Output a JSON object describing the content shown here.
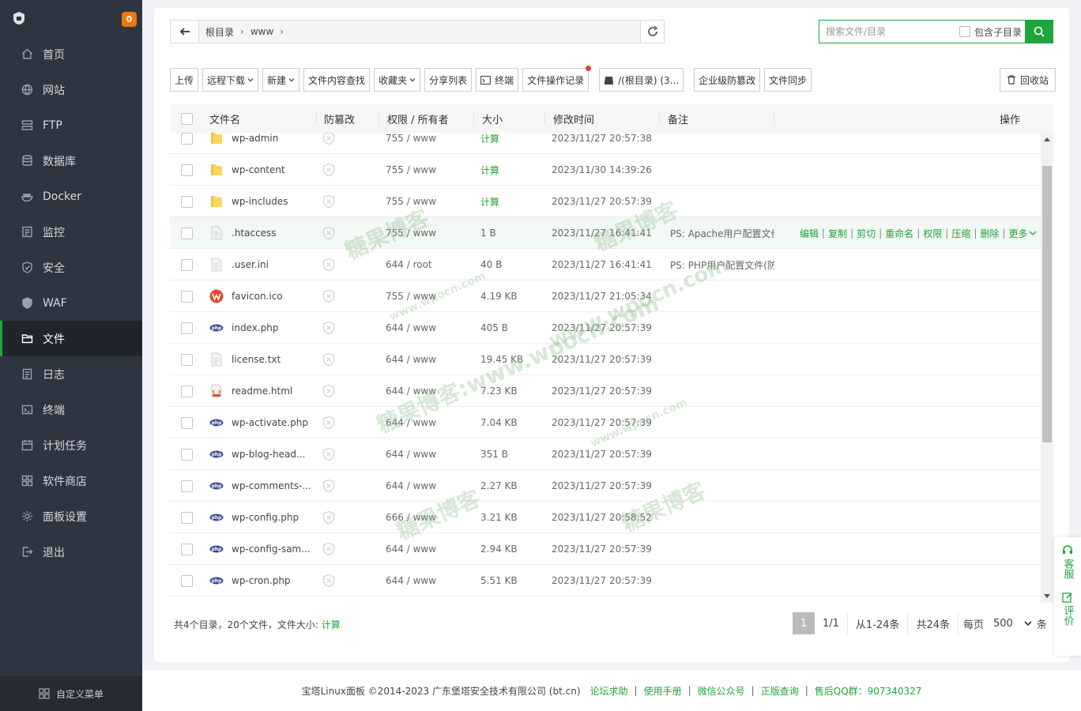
{
  "sidebar": {
    "badge": "0",
    "items": [
      {
        "label": "首页",
        "icon": "home-icon"
      },
      {
        "label": "网站",
        "icon": "globe-icon"
      },
      {
        "label": "FTP",
        "icon": "ftp-icon"
      },
      {
        "label": "数据库",
        "icon": "database-icon"
      },
      {
        "label": "Docker",
        "icon": "docker-icon"
      },
      {
        "label": "监控",
        "icon": "monitor-icon"
      },
      {
        "label": "安全",
        "icon": "shield-icon"
      },
      {
        "label": "WAF",
        "icon": "waf-icon"
      },
      {
        "label": "文件",
        "icon": "folder-icon"
      },
      {
        "label": "日志",
        "icon": "log-icon"
      },
      {
        "label": "终端",
        "icon": "terminal-icon"
      },
      {
        "label": "计划任务",
        "icon": "calendar-icon"
      },
      {
        "label": "软件商店",
        "icon": "apps-icon"
      },
      {
        "label": "面板设置",
        "icon": "gear-icon"
      },
      {
        "label": "退出",
        "icon": "logout-icon"
      }
    ],
    "active_index": 8,
    "custom_menu": "自定义菜单"
  },
  "path": {
    "crumbs": [
      "根目录",
      "www"
    ]
  },
  "search": {
    "placeholder": "搜索文件/目录",
    "include_sub": "包含子目录"
  },
  "toolbar": {
    "upload": "上传",
    "remote_download": "远程下载",
    "new": "新建",
    "content_search": "文件内容查找",
    "favorites": "收藏夹",
    "share_list": "分享列表",
    "terminal": "终端",
    "op_log": "文件操作记录",
    "disk": "/(根目录) (3...",
    "tamper": "企业级防篡改",
    "sync": "文件同步",
    "recycle": "回收站"
  },
  "table": {
    "headers": {
      "name": "文件名",
      "tamper": "防篡改",
      "perm": "权限 / 所有者",
      "size": "大小",
      "mtime": "修改时间",
      "note": "备注",
      "ops": "操作"
    },
    "rows": [
      {
        "name": "wp-admin",
        "type": "folder",
        "perm": "755 / www",
        "size": "计算",
        "mtime": "2023/11/27 20:57:38",
        "note": ""
      },
      {
        "name": "wp-content",
        "type": "folder",
        "perm": "755 / www",
        "size": "计算",
        "mtime": "2023/11/30 14:39:26",
        "note": ""
      },
      {
        "name": "wp-includes",
        "type": "folder",
        "perm": "755 / www",
        "size": "计算",
        "mtime": "2023/11/27 20:57:39",
        "note": ""
      },
      {
        "name": ".htaccess",
        "type": "text",
        "perm": "755 / www",
        "size": "1 B",
        "mtime": "2023/11/27 16:41:41",
        "note": "PS: Apache用户配置文件"
      },
      {
        "name": ".user.ini",
        "type": "text",
        "perm": "644 / root",
        "size": "40 B",
        "mtime": "2023/11/27 16:41:41",
        "note": "PS: PHP用户配置文件(防"
      },
      {
        "name": "favicon.ico",
        "type": "ico",
        "perm": "755 / www",
        "size": "4.19 KB",
        "mtime": "2023/11/27 21:05:34",
        "note": ""
      },
      {
        "name": "index.php",
        "type": "php",
        "perm": "644 / www",
        "size": "405 B",
        "mtime": "2023/11/27 20:57:39",
        "note": ""
      },
      {
        "name": "license.txt",
        "type": "text",
        "perm": "644 / www",
        "size": "19.45 KB",
        "mtime": "2023/11/27 20:57:39",
        "note": ""
      },
      {
        "name": "readme.html",
        "type": "html",
        "perm": "644 / www",
        "size": "7.23 KB",
        "mtime": "2023/11/27 20:57:39",
        "note": ""
      },
      {
        "name": "wp-activate.php",
        "type": "php",
        "perm": "644 / www",
        "size": "7.04 KB",
        "mtime": "2023/11/27 20:57:39",
        "note": ""
      },
      {
        "name": "wp-blog-head...",
        "type": "php",
        "perm": "644 / www",
        "size": "351 B",
        "mtime": "2023/11/27 20:57:39",
        "note": ""
      },
      {
        "name": "wp-comments-...",
        "type": "php",
        "perm": "644 / www",
        "size": "2.27 KB",
        "mtime": "2023/11/27 20:57:39",
        "note": ""
      },
      {
        "name": "wp-config.php",
        "type": "php",
        "perm": "666 / www",
        "size": "3.21 KB",
        "mtime": "2023/11/27 20:58:52",
        "note": ""
      },
      {
        "name": "wp-config-sam...",
        "type": "php",
        "perm": "644 / www",
        "size": "2.94 KB",
        "mtime": "2023/11/27 20:57:39",
        "note": ""
      },
      {
        "name": "wp-cron.php",
        "type": "php",
        "perm": "644 / www",
        "size": "5.51 KB",
        "mtime": "2023/11/27 20:57:39",
        "note": ""
      }
    ],
    "hover_row": 3,
    "row_actions": [
      "编辑",
      "复制",
      "剪切",
      "重命名",
      "权限",
      "压缩",
      "删除",
      "更多"
    ]
  },
  "summary": {
    "text": "共4个目录，20个文件，文件大小:",
    "calc": "计算"
  },
  "pager": {
    "current": "1",
    "pages": "1/1",
    "range": "从1-24条",
    "total": "共24条",
    "per_page_label": "每页",
    "per_page": "500",
    "unit": "条"
  },
  "footer": {
    "copyright": "宝塔Linux面板 ©2014-2023 广东堡塔安全技术有限公司 (bt.cn)",
    "links": [
      "论坛求助",
      "使用手册",
      "微信公众号",
      "正版查询",
      "售后QQ群：907340327"
    ]
  },
  "float": {
    "service": "客服",
    "review": "评价"
  },
  "watermarks": [
    "糖果博客",
    "糖果博客",
    "www.wpocn.com",
    "www.wpocn.com",
    "糖果博客:www.wpocn.com",
    "www.wpocn.com",
    "糖果博客",
    "糖果博客"
  ],
  "colors": {
    "accent": "#20a53a",
    "sidebar_bg": "#2f3540",
    "badge": "#f0770c"
  }
}
